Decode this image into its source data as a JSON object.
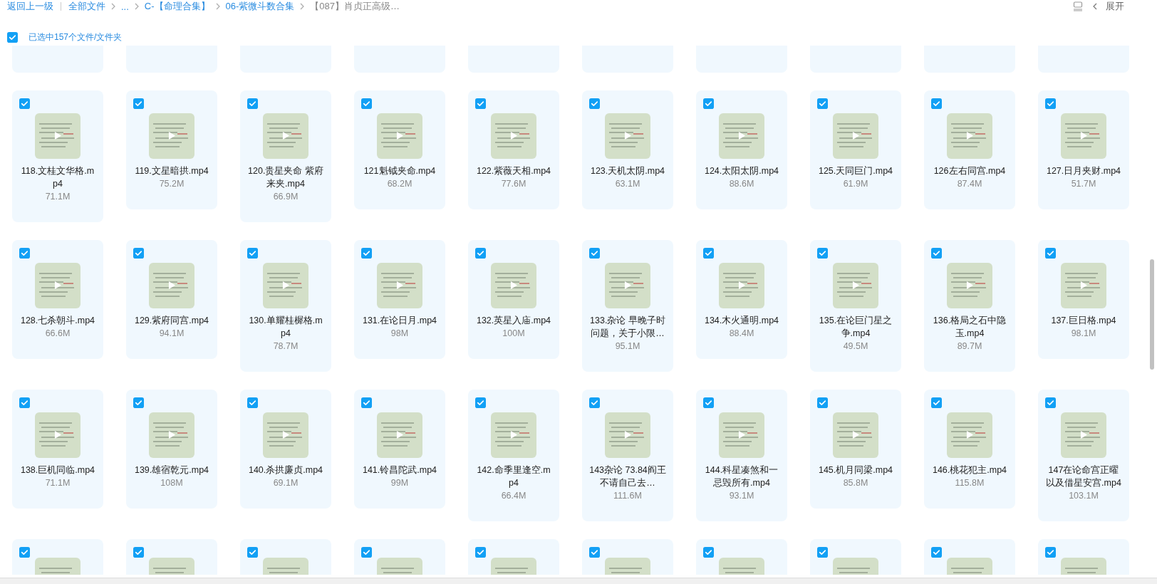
{
  "breadcrumb": {
    "back": "返回上一级",
    "items": [
      {
        "label": "全部文件",
        "kind": "link"
      },
      {
        "label": "...",
        "kind": "link"
      },
      {
        "label": "C-【命理合集】",
        "kind": "link"
      },
      {
        "label": "06-紫微斗数合集",
        "kind": "link"
      },
      {
        "label": "【087】肖贞正高级…",
        "kind": "current"
      }
    ]
  },
  "toolbar": {
    "expand": "展开"
  },
  "selection": {
    "checked": true,
    "label": "已选中157个文件/文件夹"
  },
  "files": [
    {
      "name": "118.文桂文华格.mp4",
      "size": "71.1M",
      "checked": true
    },
    {
      "name": "119.文星暗拱.mp4",
      "size": "75.2M",
      "checked": true
    },
    {
      "name": "120.贵星夹命 紫府来夹.mp4",
      "size": "66.9M",
      "checked": true
    },
    {
      "name": "121魁钺夹命.mp4",
      "size": "68.2M",
      "checked": true
    },
    {
      "name": "122.紫薇天相.mp4",
      "size": "77.6M",
      "checked": true
    },
    {
      "name": "123.天机太阴.mp4",
      "size": "63.1M",
      "checked": true
    },
    {
      "name": "124.太阳太阴.mp4",
      "size": "88.6M",
      "checked": true
    },
    {
      "name": "125.天同巨门.mp4",
      "size": "61.9M",
      "checked": true
    },
    {
      "name": "126左右同宫.mp4",
      "size": "87.4M",
      "checked": true
    },
    {
      "name": "127.日月夹财.mp4",
      "size": "51.7M",
      "checked": true
    },
    {
      "name": "128.七杀朝斗.mp4",
      "size": "66.6M",
      "checked": true
    },
    {
      "name": "129.紫府同宫.mp4",
      "size": "94.1M",
      "checked": true
    },
    {
      "name": "130.单耀桂樨格.mp4",
      "size": "78.7M",
      "checked": true
    },
    {
      "name": "131.在论日月.mp4",
      "size": "98M",
      "checked": true
    },
    {
      "name": "132.英星入庙.mp4",
      "size": "100M",
      "checked": true
    },
    {
      "name": "133.杂论 早晚子时问题，关于小限…",
      "size": "95.1M",
      "checked": true
    },
    {
      "name": "134.木火通明.mp4",
      "size": "88.4M",
      "checked": true
    },
    {
      "name": "135.在论巨门星之争.mp4",
      "size": "49.5M",
      "checked": true
    },
    {
      "name": "136.格局之石中隐玉.mp4",
      "size": "89.7M",
      "checked": true
    },
    {
      "name": "137.巨日格.mp4",
      "size": "98.1M",
      "checked": true
    },
    {
      "name": "138.巨机同临.mp4",
      "size": "71.1M",
      "checked": true
    },
    {
      "name": "139.雄宿乾元.mp4",
      "size": "108M",
      "checked": true
    },
    {
      "name": "140.杀拱廉贞.mp4",
      "size": "69.1M",
      "checked": true
    },
    {
      "name": "141.铃昌陀武.mp4",
      "size": "99M",
      "checked": true
    },
    {
      "name": "142.命季里逢空.mp4",
      "size": "66.4M",
      "checked": true
    },
    {
      "name": "143杂论 73.84阎王不请自己去…",
      "size": "111.6M",
      "checked": true
    },
    {
      "name": "144.科星凑煞和一忌毁所有.mp4",
      "size": "93.1M",
      "checked": true
    },
    {
      "name": "145.机月同梁.mp4",
      "size": "85.8M",
      "checked": true
    },
    {
      "name": "146.桃花犯主.mp4",
      "size": "115.8M",
      "checked": true
    },
    {
      "name": "147在论命宫正曜以及借星安宫.mp4",
      "size": "103.1M",
      "checked": true
    }
  ],
  "partial_files": [
    {
      "checked": true
    },
    {
      "checked": true
    },
    {
      "checked": true
    },
    {
      "checked": true
    },
    {
      "checked": true
    },
    {
      "checked": true
    },
    {
      "checked": true
    },
    {
      "checked": true
    },
    {
      "checked": true
    },
    {
      "checked": true
    }
  ]
}
